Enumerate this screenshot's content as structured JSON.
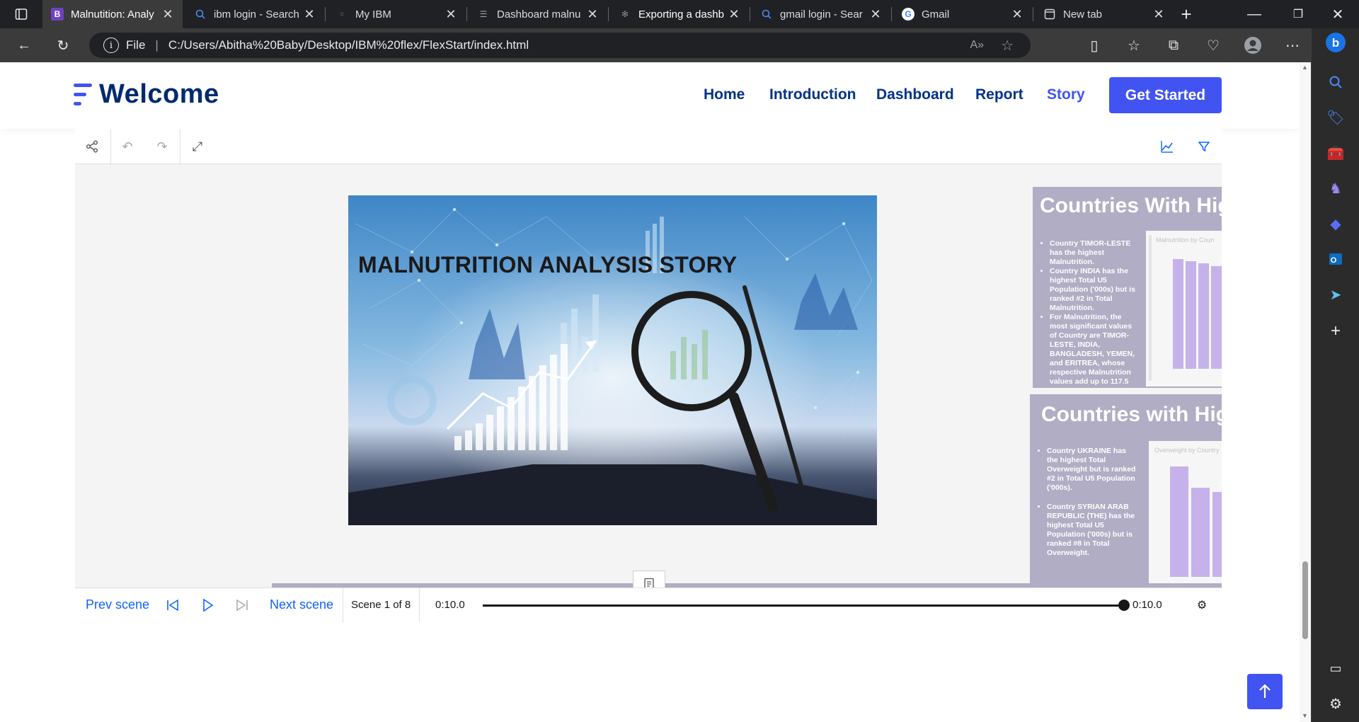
{
  "browser": {
    "tabs": [
      {
        "title": "Malnutition: Analy",
        "favicon": "B",
        "active": true
      },
      {
        "title": "ibm login - Search",
        "favicon": "search-icon"
      },
      {
        "title": "My IBM",
        "favicon": "ibm-icon"
      },
      {
        "title": "Dashboard malnu",
        "favicon": "dashboard-icon"
      },
      {
        "title": "Exporting a dashb",
        "favicon": "community-icon"
      },
      {
        "title": "gmail login - Sear",
        "favicon": "search-icon"
      },
      {
        "title": "Gmail",
        "favicon": "google-icon"
      },
      {
        "title": "New tab",
        "favicon": "newtab-icon"
      }
    ],
    "address": {
      "scheme_label": "File",
      "url": "C:/Users/Abitha%20Baby/Desktop/IBM%20flex/FlexStart/index.html"
    }
  },
  "site": {
    "logo_text": "Welcome",
    "nav": [
      "Home",
      "Introduction",
      "Dashboard",
      "Report",
      "Story"
    ],
    "active_nav": "Story",
    "cta_label": "Get Started",
    "brand_color": "#4154f1",
    "heading_color": "#012970"
  },
  "story": {
    "hero_title": "MALNUTRITION ANALYSIS STORY",
    "side_cards": [
      {
        "title": "Countries With Hig",
        "bullets": [
          "Country TIMOR-LESTE has the highest Malnutrition.",
          "Country INDIA has the highest Total U5 Population ('000s) but is ranked #2 in Total Malnutrition.",
          "For Malnutrition, the most significant values of Country are TIMOR-LESTE, INDIA, BANGLADESH, YEMEN, and ERITREA, whose respective Malnutrition values add up to 117.5"
        ],
        "chart_label": "Malnutrition by Coun"
      },
      {
        "title": "Countries with Hig",
        "bullets": [
          "Country UKRAINE has the highest Total Overweight but is ranked #2 in Total U5 Population ('000s).",
          "Country SYRIAN ARAB REPUBLIC (THE) has the highest Total U5 Population ('000s) but is ranked #8 in Total Overweight."
        ],
        "chart_label": "Overweight by Country"
      }
    ],
    "playback": {
      "prev_label": "Prev scene",
      "next_label": "Next scene",
      "scene_label": "Scene 1 of 8",
      "time_current": "0:10.0",
      "time_total": "0:10.0",
      "progress": 1.0
    }
  }
}
